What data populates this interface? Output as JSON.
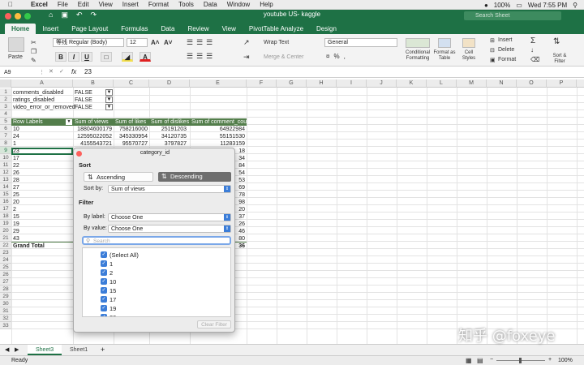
{
  "menubar": {
    "app": "Excel",
    "items": [
      "File",
      "Edit",
      "View",
      "Insert",
      "Format",
      "Tools",
      "Data",
      "Window",
      "Help"
    ],
    "battery": "100%",
    "clock": "Wed 7:55 PM"
  },
  "window": {
    "title": "youtube US- kaggle",
    "search_placeholder": "Search Sheet"
  },
  "ribbon_tabs": [
    "Home",
    "Insert",
    "Page Layout",
    "Formulas",
    "Data",
    "Review",
    "View",
    "PivotTable Analyze",
    "Design"
  ],
  "ribbon": {
    "paste": "Paste",
    "font_name": "等线 Regular (Body)",
    "font_size": "12",
    "wrap_text": "Wrap Text",
    "merge_center": "Merge & Center",
    "number_format": "General",
    "conditional": "Conditional Formatting",
    "format_table": "Format as Table",
    "cell_styles": "Cell Styles",
    "insert": "Insert",
    "delete": "Delete",
    "format": "Format",
    "sort_filter": "Sort & Filter"
  },
  "formula_bar": {
    "name_box": "A9",
    "fx": "fx",
    "value": "23"
  },
  "columns": [
    "A",
    "B",
    "C",
    "D",
    "E",
    "F",
    "G",
    "H",
    "I",
    "J",
    "K",
    "L",
    "M",
    "N",
    "O",
    "P"
  ],
  "rows": [
    "1",
    "2",
    "3",
    "4",
    "5",
    "6",
    "7",
    "8",
    "9",
    "10",
    "11",
    "12",
    "13",
    "14",
    "15",
    "16",
    "17",
    "18",
    "19",
    "20",
    "21",
    "22",
    "23",
    "24",
    "25",
    "26",
    "27",
    "28",
    "29",
    "30",
    "31",
    "32",
    "33"
  ],
  "filters": [
    {
      "label": "comments_disabled",
      "value": "FALSE"
    },
    {
      "label": "ratings_disabled",
      "value": "FALSE"
    },
    {
      "label": "video_error_or_removed",
      "value": "FALSE"
    }
  ],
  "pivot": {
    "headers": [
      "Row Labels",
      "Sum of views",
      "Sum of likes",
      "Sum of dislikes",
      "Sum of comment_count"
    ],
    "data": [
      [
        "10",
        "18804600179",
        "758216000",
        "25191203",
        "64922984"
      ],
      [
        "24",
        "12595022052",
        "345330954",
        "34120735",
        "55151530"
      ],
      [
        "1",
        "4155543721",
        "95570727",
        "3797827",
        "11283159"
      ]
    ],
    "labels": [
      "23",
      "17",
      "22",
      "26",
      "28",
      "27",
      "25",
      "20",
      "2",
      "15",
      "19",
      "29",
      "43"
    ],
    "tail": [
      "18",
      "34",
      "84",
      "54",
      "53",
      "69",
      "78",
      "98",
      "20",
      "37",
      "26",
      "46",
      "80"
    ],
    "grand_total": "Grand Total",
    "grand_tail": "36"
  },
  "dialog": {
    "title": "category_id",
    "sort": "Sort",
    "ascending": "Ascending",
    "descending": "Descending",
    "sort_by_label": "Sort by:",
    "sort_by_value": "Sum of views",
    "filter": "Filter",
    "by_label": "By label:",
    "by_label_value": "Choose One",
    "by_value": "By value:",
    "by_value_value": "Choose One",
    "search_placeholder": "Search",
    "items": [
      "(Select All)",
      "1",
      "2",
      "10",
      "15",
      "17",
      "19",
      "20"
    ],
    "clear_filter": "Clear Filter"
  },
  "sheets": [
    "Sheet3",
    "Sheet1"
  ],
  "status": {
    "ready": "Ready",
    "zoom": "100%"
  },
  "watermark": "知乎 @foxeye",
  "colors": {
    "excel_green": "#1e7145",
    "pivot_header": "#537e4b",
    "checkbox_blue": "#3b7dd8",
    "descending_bg": "#6e6e6e"
  }
}
